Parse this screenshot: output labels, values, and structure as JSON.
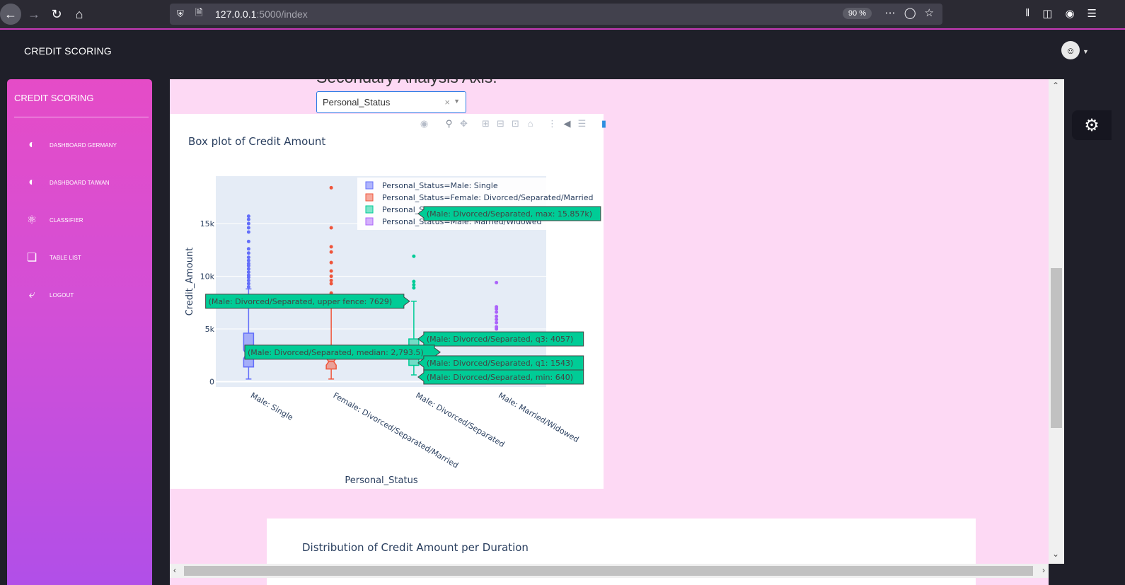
{
  "browser": {
    "url_host": "127.0.0.1",
    "url_path": ":5000/index",
    "zoom": "90 %"
  },
  "header": {
    "brand": "CREDIT SCORING"
  },
  "sidebar": {
    "brand": "CREDIT SCORING",
    "items": [
      {
        "label": "DASHBOARD GERMANY",
        "icon": "pie-chart-icon"
      },
      {
        "label": "DASHBOARD TAIWAN",
        "icon": "pie-chart-icon"
      },
      {
        "label": "CLASSIFIER",
        "icon": "atom-icon"
      },
      {
        "label": "TABLE LIST",
        "icon": "puzzle-icon"
      },
      {
        "label": "LOGOUT",
        "icon": "running-man-icon"
      }
    ]
  },
  "main": {
    "section_title": "Secondary Analysis Axis:",
    "select": {
      "value": "Personal_Status",
      "clear": "×"
    },
    "card2_title": "Distribution of Credit Amount per Duration"
  },
  "chart_data": {
    "type": "box",
    "title": "Box plot of Credit Amount",
    "xlabel": "Personal_Status",
    "ylabel": "Credit_Amount",
    "ylim": [
      -500,
      19500
    ],
    "yticks": [
      {
        "value": 0,
        "label": "0"
      },
      {
        "value": 5000,
        "label": "5k"
      },
      {
        "value": 10000,
        "label": "10k"
      },
      {
        "value": 15000,
        "label": "15k"
      }
    ],
    "categories": [
      "Male: Single",
      "Female: Divorced/Separated/Married",
      "Male: Divorced/Separated",
      "Male: Married/Widowed"
    ],
    "legend": [
      "Personal_Status=Male: Single",
      "Personal_Status=Female: Divorced/Separated/Married",
      "Personal_Status=Male: Divorced/Separated",
      "Personal_Status=Male: Married/Widowed"
    ],
    "series": [
      {
        "name": "Male: Single",
        "color": "#636efa",
        "min": 250,
        "q1": 1400,
        "median": 2600,
        "q3": 4600,
        "upper": 8800,
        "outliers": [
          9000,
          9300,
          9600,
          9900,
          10100,
          10400,
          10700,
          11000,
          11200,
          11500,
          11800,
          12200,
          12600,
          13300,
          14200,
          14600,
          15000,
          15400,
          15700
        ]
      },
      {
        "name": "Female: Divorced/Separated/Married",
        "color": "#ef553b",
        "min": 250,
        "q1": 1200,
        "median": 1900,
        "q3": 2200,
        "upper": 8000,
        "outliers": [
          8400,
          9300,
          9600,
          10000,
          10500,
          11300,
          12300,
          12800,
          14600,
          18400
        ]
      },
      {
        "name": "Male: Divorced/Separated",
        "color": "#00cc96",
        "min": 640,
        "q1": 1543,
        "median": 2793.5,
        "q3": 4057,
        "upper": 7629,
        "max": 15857,
        "outliers": [
          8900,
          9200,
          9500,
          11900
        ]
      },
      {
        "name": "Male: Married/Widowed",
        "color": "#ab63fa",
        "min": 1500,
        "q1": 1500,
        "median": 1500,
        "q3": 1500,
        "upper": 1500,
        "outliers": [
          5000,
          5200,
          5600,
          5900,
          6200,
          6600,
          6900,
          7100,
          9400
        ]
      }
    ],
    "hover_labels": [
      "(Male: Divorced/Separated, max: 15.857k)",
      "(Male: Divorced/Separated, upper fence: 7629)",
      "(Male: Divorced/Separated, q3: 4057)",
      "(Male: Divorced/Separated, median: 2,793.5)",
      "(Male: Divorced/Separated, q1: 1543)",
      "(Male: Divorced/Separated, min: 640)"
    ],
    "colors": {
      "hover": "#00cc96",
      "plot_bg": "#e5ecf6",
      "grid": "#ffffff",
      "axis_text": "#2a3f5f"
    }
  }
}
